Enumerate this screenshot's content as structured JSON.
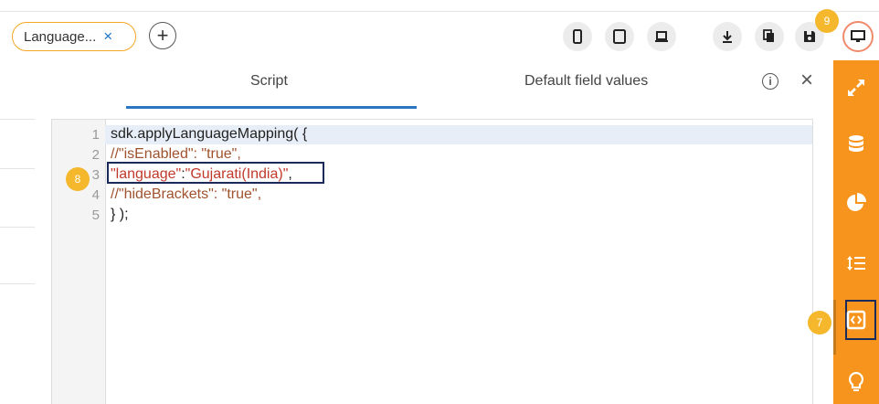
{
  "tab": {
    "label": "Language...",
    "close": "×"
  },
  "add_label": "+",
  "badges": {
    "save_badge": "9",
    "line_badge": "8",
    "script_badge": "7"
  },
  "panel": {
    "tabs": [
      "Script",
      "Default field values"
    ],
    "active_tab": "Script"
  },
  "code": {
    "line_numbers": [
      "1",
      "2",
      "3",
      "4",
      "5"
    ],
    "line1": "sdk.applyLanguageMapping( {",
    "line2": "//\"isEnabled\": \"true\",",
    "line3_key": "\"language\"",
    "line3_sep": ":",
    "line3_val": "\"Gujarati(India)\"",
    "line3_end": ",",
    "line4": "//\"hideBrackets\": \"true\",",
    "line5": "} );"
  },
  "colors": {
    "accent": "#f7941d",
    "highlight_box": "#1a2a5a",
    "tab_underline": "#2a76c2",
    "badge": "#f5b72c"
  }
}
